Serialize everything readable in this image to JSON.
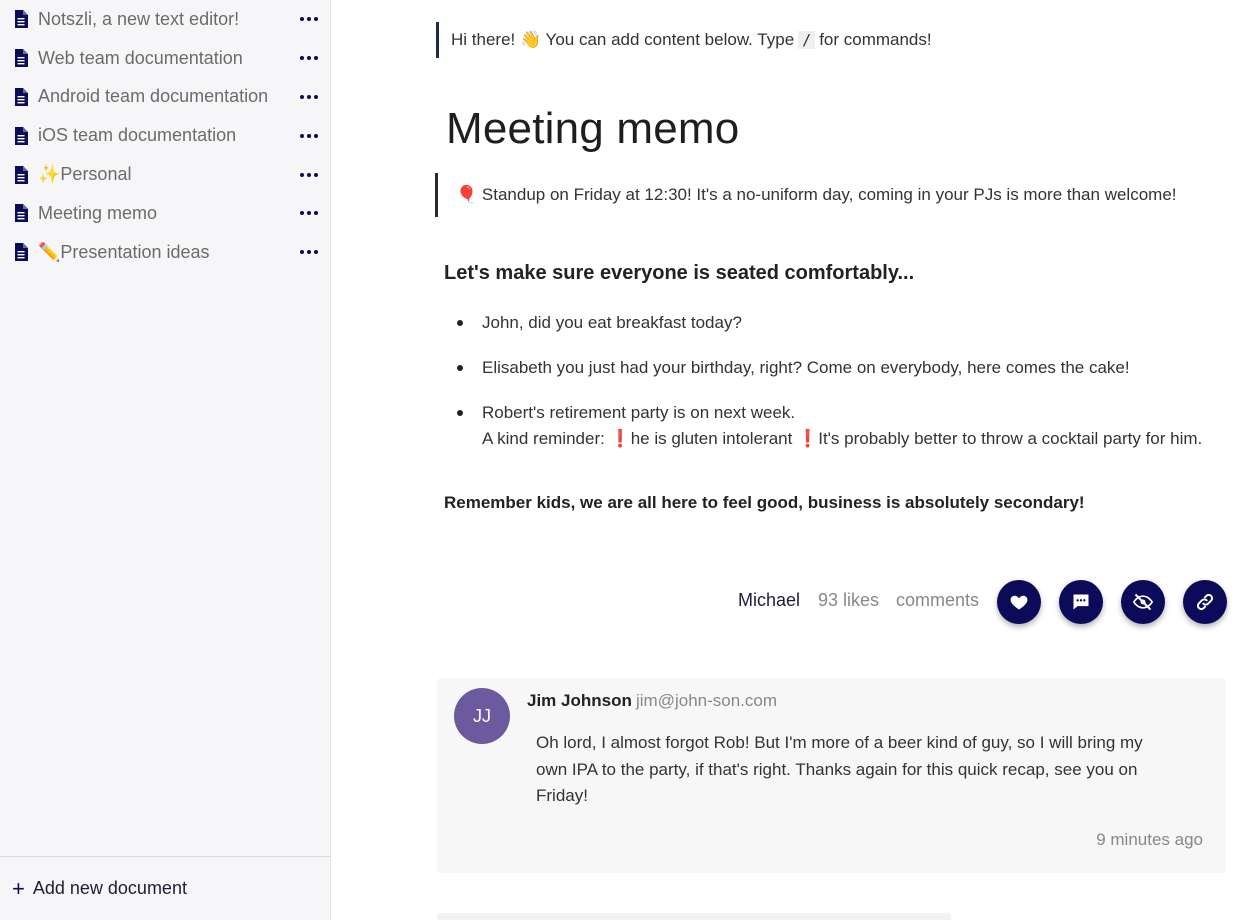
{
  "sidebar": {
    "documents": [
      {
        "label": "Notszli, a new text editor!",
        "emoji": ""
      },
      {
        "label": "Web team documentation",
        "emoji": ""
      },
      {
        "label": "Android team documentation",
        "emoji": ""
      },
      {
        "label": "iOS team documentation",
        "emoji": ""
      },
      {
        "label": "Personal",
        "emoji": "✨"
      },
      {
        "label": "Meeting memo",
        "emoji": ""
      },
      {
        "label": "Presentation ideas",
        "emoji": "✏️"
      }
    ],
    "add_label": "Add new document"
  },
  "editor": {
    "hint_prefix": "Hi there! 👋  You can add content below. Type",
    "hint_command": "/",
    "hint_suffix": "for commands!",
    "title": "Meeting memo",
    "callout": "🎈 Standup on Friday at 12:30! It's a no-uniform day, coming in your PJs is more than welcome!",
    "heading": "Let's make sure everyone is seated comfortably...",
    "bullets": [
      {
        "line1": "John, did you eat breakfast today?",
        "line2": ""
      },
      {
        "line1": "Elisabeth you just had your birthday, right? Come on everybody, here comes the cake!",
        "line2": ""
      },
      {
        "line1": "Robert's retirement party is on next week.",
        "line2": "A kind reminder: ❗he is gluten intolerant ❗It's probably better to throw a cocktail party for him."
      }
    ],
    "closing": "Remember kids, we are all here to feel good, business is absolutely secondary!"
  },
  "meta": {
    "author": "Michael",
    "likes": "93 likes",
    "comments": "comments",
    "actions": [
      "heart-icon",
      "comment-icon",
      "eye-off-icon",
      "link-icon"
    ]
  },
  "comment": {
    "initials": "JJ",
    "name": "Jim Johnson",
    "email": "jim@john-son.com",
    "body": "Oh lord, I almost forgot Rob! But I'm more of a beer kind of guy, so I will bring my own IPA to the party, if that's right. Thanks again for this quick recap, see you on Friday!",
    "time": "9 minutes ago"
  },
  "colors": {
    "accent": "#0b0b5a",
    "avatar": "#6c5a9e",
    "sidebar_bg": "#f6f6f8"
  }
}
